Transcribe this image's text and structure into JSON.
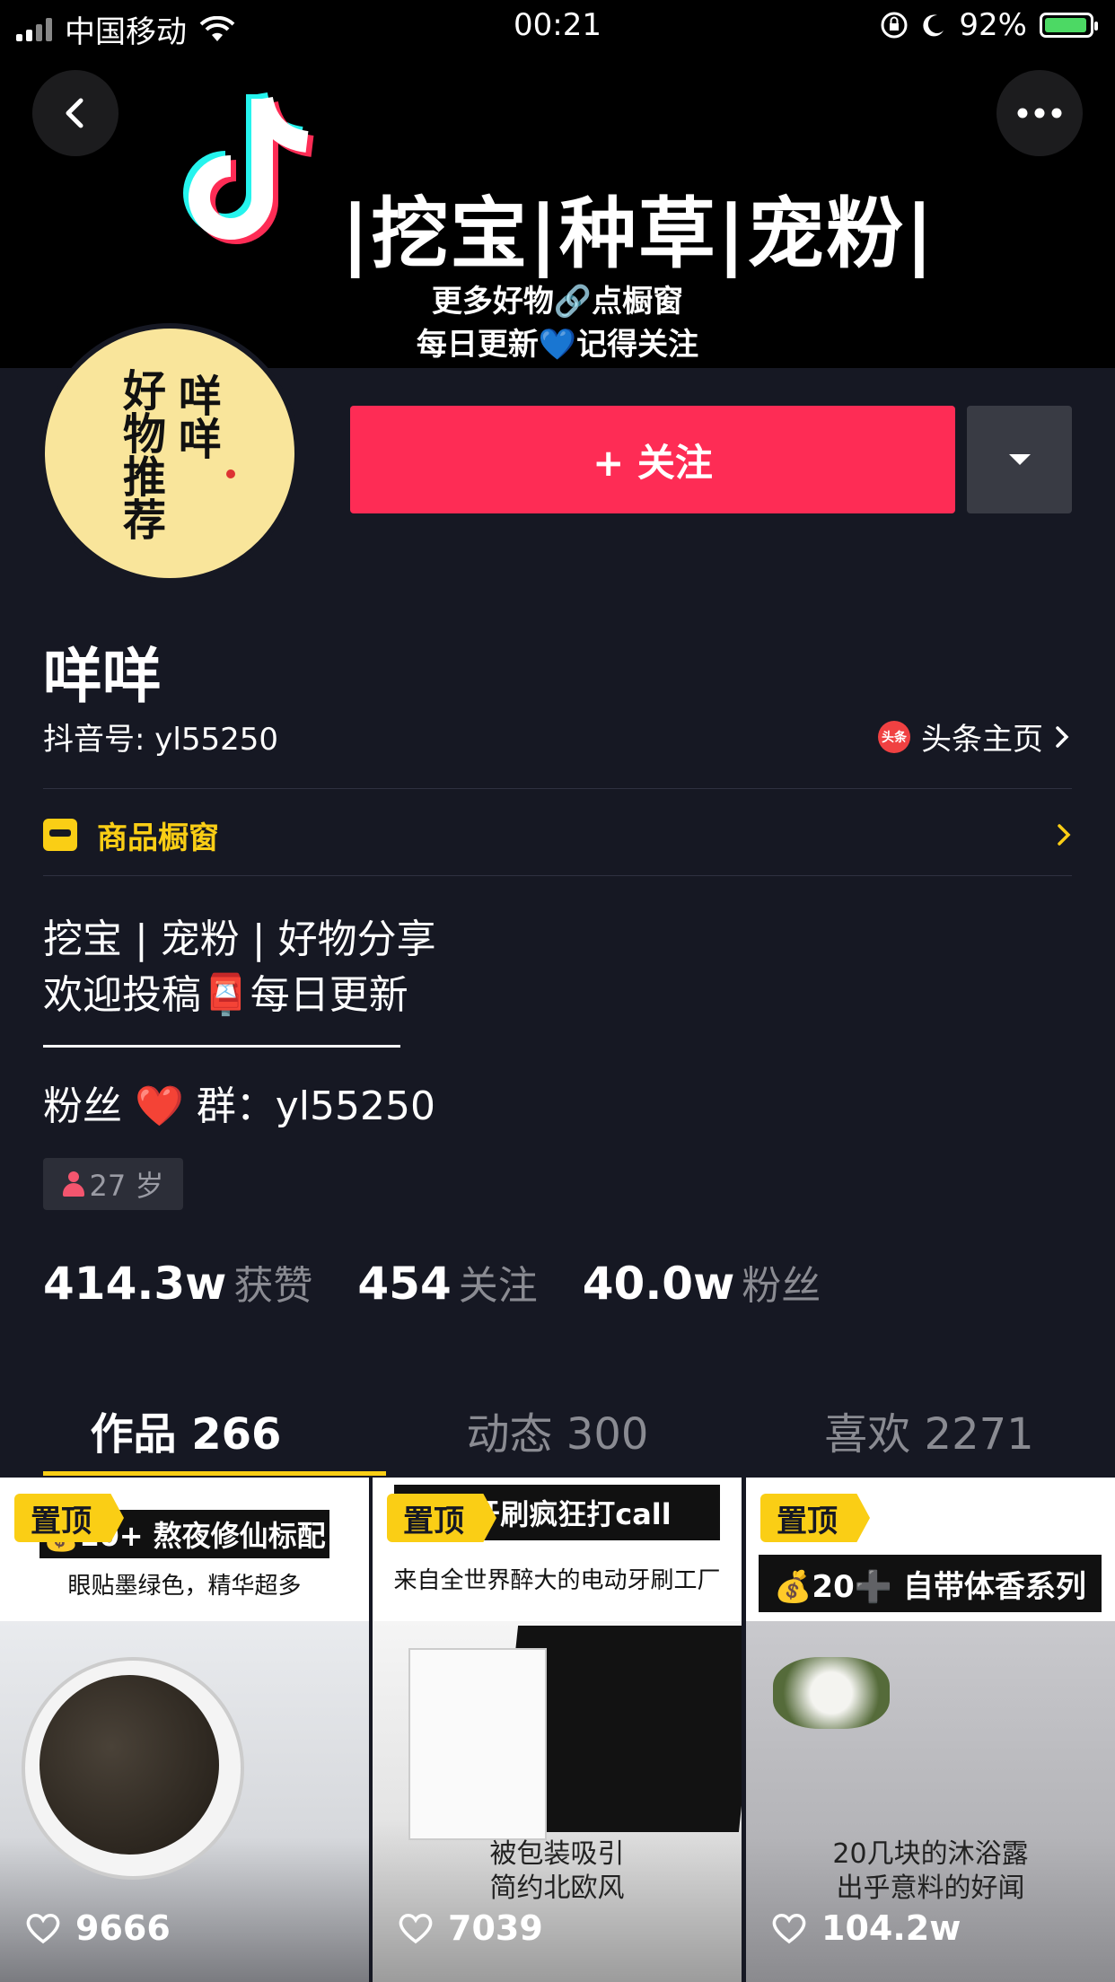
{
  "status_bar": {
    "carrier": "中国移动",
    "time": "00:21",
    "battery": "92%"
  },
  "banner": {
    "title": "|挖宝|种草|宠粉|",
    "sub1": "更多好物🔗点橱窗",
    "sub2": "每日更新💙记得关注"
  },
  "avatar": {
    "col1": "咩咩",
    "col2": "好物推荐"
  },
  "follow_button": {
    "label": "+ 关注"
  },
  "profile": {
    "name": "咩咩",
    "douyin_id": "抖音号: yl55250",
    "toutiao_link": "头条主页",
    "toutiao_icon_text": "头条"
  },
  "shop": {
    "label": "商品橱窗"
  },
  "bio": {
    "line1": "挖宝 | 宠粉 | 好物分享",
    "line2": "欢迎投稿📮每日更新",
    "line3": "粉丝 ❤️ 群：yl55250"
  },
  "age": {
    "label": "27 岁"
  },
  "stats": [
    {
      "num": "414.3w",
      "label": "获赞"
    },
    {
      "num": "454",
      "label": "关注"
    },
    {
      "num": "40.0w",
      "label": "粉丝"
    }
  ],
  "tabs": [
    {
      "label": "作品 266"
    },
    {
      "label": "动态 300"
    },
    {
      "label": "喜欢 2271"
    }
  ],
  "videos": [
    {
      "pin": "置顶",
      "label": "💰10+ 熬夜修仙标配",
      "sub": "眼贴墨绿色，精华超多",
      "caption1": "",
      "caption2": "",
      "likes": "9666"
    },
    {
      "pin": "置顶",
      "label": "款牙刷疯狂打call",
      "sub": "来自全世界醉大的电动牙刷工厂",
      "caption1": "被包装吸引",
      "caption2": "简约北欧风",
      "likes": "7039"
    },
    {
      "pin": "置顶",
      "label": "💰20➕ 自带体香系列",
      "sub": "",
      "caption1": "20几块的沐浴露",
      "caption2": "出乎意料的好闻",
      "likes": "104.2w"
    }
  ]
}
